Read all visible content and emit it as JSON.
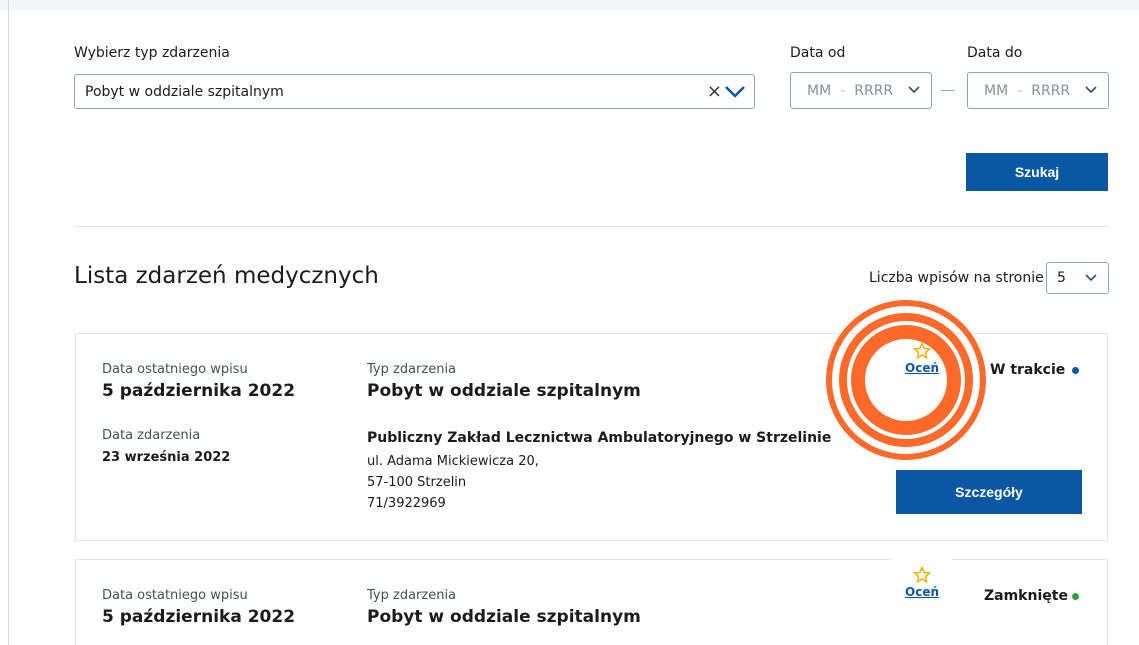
{
  "filters": {
    "event_type_label": "Wybierz typ zdarzenia",
    "event_type_value": "Pobyt w oddziale szpitalnym",
    "clear_symbol": "×",
    "date_from_label": "Data od",
    "date_to_label": "Data do",
    "month_placeholder": "MM",
    "year_placeholder": "RRRR",
    "date_separator": "-",
    "search_button": "Szukaj"
  },
  "list": {
    "title": "Lista zdarzeń medycznych",
    "per_page_label": "Liczba wpisów na stronie",
    "per_page_value": "5"
  },
  "events": [
    {
      "last_entry_label": "Data ostatniego wpisu",
      "last_entry_date": "5 października 2022",
      "event_type_label": "Typ zdarzenia",
      "event_type": "Pobyt w oddziale szpitalnym",
      "event_date_label": "Data zdarzenia",
      "event_date": "23 września 2022",
      "facility": "Publiczny Zakład Lecznictwa Ambulatoryjnego w Strzelinie",
      "address_line1": "ul. Adama Mickiewicza 20,",
      "address_line2": "57-100 Strzelin",
      "phone": "71/3922969",
      "rate_label": "Oceń",
      "status": "W trakcie",
      "status_color": "#0a58a4",
      "details_button": "Szczegóły"
    },
    {
      "last_entry_label": "Data ostatniego wpisu",
      "last_entry_date": "5 października 2022",
      "event_type_label": "Typ zdarzenia",
      "event_type": "Pobyt w oddziale szpitalnym",
      "rate_label": "Oceń",
      "status": "Zamknięte",
      "status_color": "#2ea043"
    }
  ],
  "colors": {
    "primary": "#0a58a4",
    "star": "#e8b400",
    "highlight": "#ff6a2b"
  }
}
